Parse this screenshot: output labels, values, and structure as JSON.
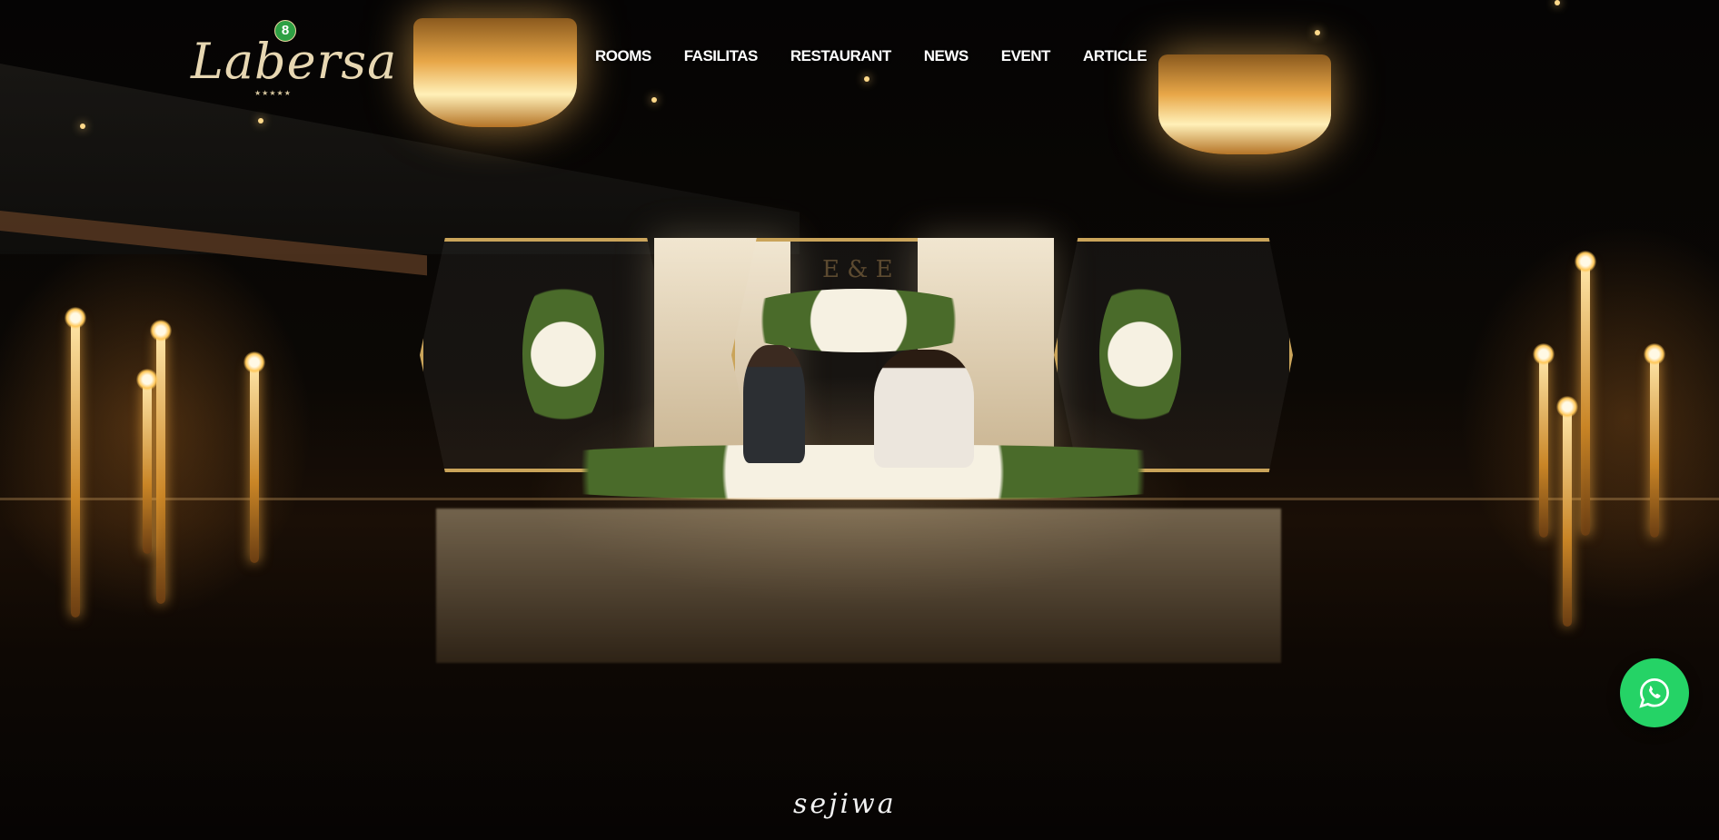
{
  "brand": {
    "name": "Labersa",
    "badge": "8",
    "stars": "★★★★★"
  },
  "nav": {
    "items": [
      {
        "label": "ROOMS"
      },
      {
        "label": "FASILITAS"
      },
      {
        "label": "RESTAURANT"
      },
      {
        "label": "NEWS"
      },
      {
        "label": "EVENT"
      },
      {
        "label": "ARTICLE"
      }
    ]
  },
  "hero": {
    "watermark": "sejiwa",
    "stage_initials": "E & E"
  },
  "whatsapp": {
    "icon": "whatsapp-icon",
    "color": "#25d366"
  },
  "colors": {
    "nav_text": "#ffffff",
    "accent_gold": "#caa45a",
    "whatsapp": "#25d366"
  }
}
